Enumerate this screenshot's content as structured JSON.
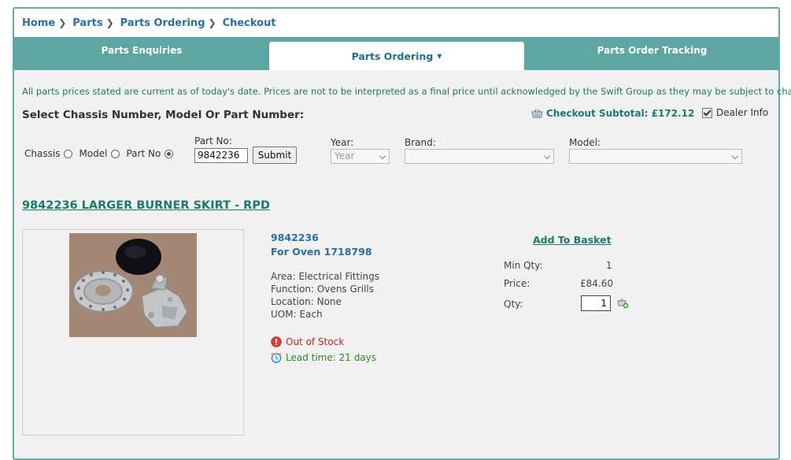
{
  "breadcrumb": [
    {
      "label": "Home"
    },
    {
      "label": "Parts"
    },
    {
      "label": "Parts Ordering"
    },
    {
      "label": "Checkout"
    }
  ],
  "tabs": [
    {
      "label": "Parts Enquiries"
    },
    {
      "label": "Parts Ordering"
    },
    {
      "label": "Parts Order Tracking"
    }
  ],
  "notice": "All parts prices stated are current as of today's date. Prices are not to be interpreted as a final price until acknowledged by the Swift Group as they may be subject to change.",
  "select_title": "Select Chassis Number, Model Or Part Number:",
  "subtotal": "Checkout Subtotal: £172.12",
  "dealer_info": "Dealer Info",
  "search": {
    "radio_chassis": "Chassis",
    "radio_model": "Model",
    "radio_partno": "Part No",
    "partno_label": "Part No:",
    "partno_value": "9842236",
    "submit_label": "Submit",
    "year_label": "Year:",
    "year_value": "Year",
    "brand_label": "Brand:",
    "brand_value": "",
    "model_label": "Model:",
    "model_value": ""
  },
  "product": {
    "title": "9842236 LARGER BURNER SKIRT - RPD",
    "id": "9842236",
    "for_oven": "For Oven 1718798",
    "area": "Area: Electrical Fittings",
    "function": "Function: Ovens Grills",
    "location": "Location: None",
    "uom": "UOM: Each",
    "stock_status": "Out of Stock",
    "lead_time": "Lead time: 21 days",
    "add_to_basket": "Add To Basket",
    "min_qty_label": "Min Qty:",
    "min_qty_value": "1",
    "price_label": "Price:",
    "price_value": "£84.60",
    "qty_label": "Qty:",
    "qty_value": "1"
  },
  "colors": {
    "teal": "#5fa5a1",
    "link_blue": "#2b6ea3",
    "green": "#1d7a6b",
    "out_of_stock": "#cc1f1f",
    "lead_time": "#2b8a2b"
  }
}
